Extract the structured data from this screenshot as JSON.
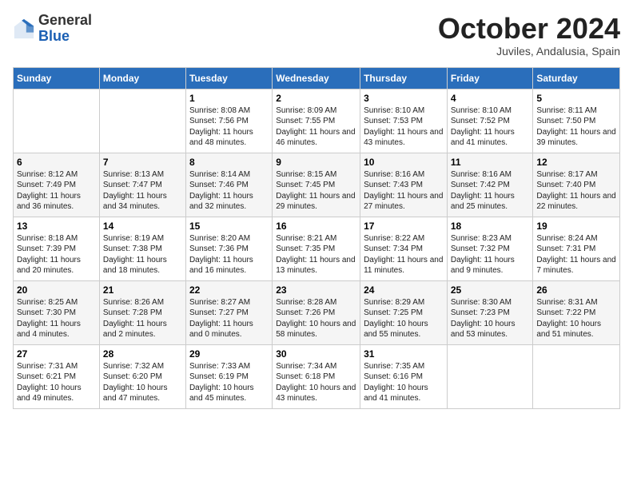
{
  "header": {
    "logo_general": "General",
    "logo_blue": "Blue",
    "month_title": "October 2024",
    "location": "Juviles, Andalusia, Spain"
  },
  "columns": [
    "Sunday",
    "Monday",
    "Tuesday",
    "Wednesday",
    "Thursday",
    "Friday",
    "Saturday"
  ],
  "weeks": [
    [
      {
        "day": "",
        "detail": ""
      },
      {
        "day": "",
        "detail": ""
      },
      {
        "day": "1",
        "detail": "Sunrise: 8:08 AM\nSunset: 7:56 PM\nDaylight: 11 hours and 48 minutes."
      },
      {
        "day": "2",
        "detail": "Sunrise: 8:09 AM\nSunset: 7:55 PM\nDaylight: 11 hours and 46 minutes."
      },
      {
        "day": "3",
        "detail": "Sunrise: 8:10 AM\nSunset: 7:53 PM\nDaylight: 11 hours and 43 minutes."
      },
      {
        "day": "4",
        "detail": "Sunrise: 8:10 AM\nSunset: 7:52 PM\nDaylight: 11 hours and 41 minutes."
      },
      {
        "day": "5",
        "detail": "Sunrise: 8:11 AM\nSunset: 7:50 PM\nDaylight: 11 hours and 39 minutes."
      }
    ],
    [
      {
        "day": "6",
        "detail": "Sunrise: 8:12 AM\nSunset: 7:49 PM\nDaylight: 11 hours and 36 minutes."
      },
      {
        "day": "7",
        "detail": "Sunrise: 8:13 AM\nSunset: 7:47 PM\nDaylight: 11 hours and 34 minutes."
      },
      {
        "day": "8",
        "detail": "Sunrise: 8:14 AM\nSunset: 7:46 PM\nDaylight: 11 hours and 32 minutes."
      },
      {
        "day": "9",
        "detail": "Sunrise: 8:15 AM\nSunset: 7:45 PM\nDaylight: 11 hours and 29 minutes."
      },
      {
        "day": "10",
        "detail": "Sunrise: 8:16 AM\nSunset: 7:43 PM\nDaylight: 11 hours and 27 minutes."
      },
      {
        "day": "11",
        "detail": "Sunrise: 8:16 AM\nSunset: 7:42 PM\nDaylight: 11 hours and 25 minutes."
      },
      {
        "day": "12",
        "detail": "Sunrise: 8:17 AM\nSunset: 7:40 PM\nDaylight: 11 hours and 22 minutes."
      }
    ],
    [
      {
        "day": "13",
        "detail": "Sunrise: 8:18 AM\nSunset: 7:39 PM\nDaylight: 11 hours and 20 minutes."
      },
      {
        "day": "14",
        "detail": "Sunrise: 8:19 AM\nSunset: 7:38 PM\nDaylight: 11 hours and 18 minutes."
      },
      {
        "day": "15",
        "detail": "Sunrise: 8:20 AM\nSunset: 7:36 PM\nDaylight: 11 hours and 16 minutes."
      },
      {
        "day": "16",
        "detail": "Sunrise: 8:21 AM\nSunset: 7:35 PM\nDaylight: 11 hours and 13 minutes."
      },
      {
        "day": "17",
        "detail": "Sunrise: 8:22 AM\nSunset: 7:34 PM\nDaylight: 11 hours and 11 minutes."
      },
      {
        "day": "18",
        "detail": "Sunrise: 8:23 AM\nSunset: 7:32 PM\nDaylight: 11 hours and 9 minutes."
      },
      {
        "day": "19",
        "detail": "Sunrise: 8:24 AM\nSunset: 7:31 PM\nDaylight: 11 hours and 7 minutes."
      }
    ],
    [
      {
        "day": "20",
        "detail": "Sunrise: 8:25 AM\nSunset: 7:30 PM\nDaylight: 11 hours and 4 minutes."
      },
      {
        "day": "21",
        "detail": "Sunrise: 8:26 AM\nSunset: 7:28 PM\nDaylight: 11 hours and 2 minutes."
      },
      {
        "day": "22",
        "detail": "Sunrise: 8:27 AM\nSunset: 7:27 PM\nDaylight: 11 hours and 0 minutes."
      },
      {
        "day": "23",
        "detail": "Sunrise: 8:28 AM\nSunset: 7:26 PM\nDaylight: 10 hours and 58 minutes."
      },
      {
        "day": "24",
        "detail": "Sunrise: 8:29 AM\nSunset: 7:25 PM\nDaylight: 10 hours and 55 minutes."
      },
      {
        "day": "25",
        "detail": "Sunrise: 8:30 AM\nSunset: 7:23 PM\nDaylight: 10 hours and 53 minutes."
      },
      {
        "day": "26",
        "detail": "Sunrise: 8:31 AM\nSunset: 7:22 PM\nDaylight: 10 hours and 51 minutes."
      }
    ],
    [
      {
        "day": "27",
        "detail": "Sunrise: 7:31 AM\nSunset: 6:21 PM\nDaylight: 10 hours and 49 minutes."
      },
      {
        "day": "28",
        "detail": "Sunrise: 7:32 AM\nSunset: 6:20 PM\nDaylight: 10 hours and 47 minutes."
      },
      {
        "day": "29",
        "detail": "Sunrise: 7:33 AM\nSunset: 6:19 PM\nDaylight: 10 hours and 45 minutes."
      },
      {
        "day": "30",
        "detail": "Sunrise: 7:34 AM\nSunset: 6:18 PM\nDaylight: 10 hours and 43 minutes."
      },
      {
        "day": "31",
        "detail": "Sunrise: 7:35 AM\nSunset: 6:16 PM\nDaylight: 10 hours and 41 minutes."
      },
      {
        "day": "",
        "detail": ""
      },
      {
        "day": "",
        "detail": ""
      }
    ]
  ]
}
